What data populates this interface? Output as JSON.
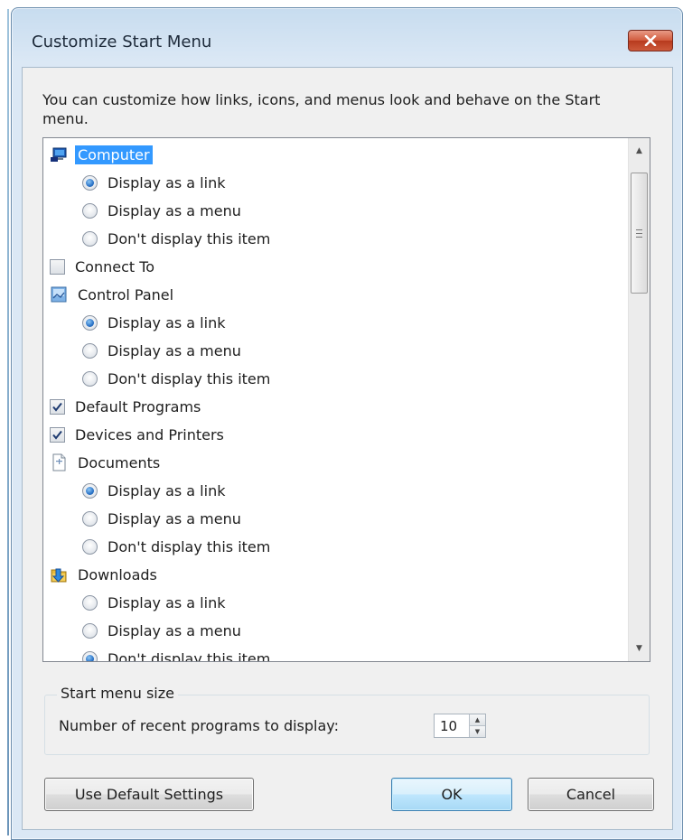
{
  "window": {
    "title": "Customize Start Menu"
  },
  "intro_text": "You can customize how links, icons, and menus look and behave on the Start menu.",
  "list": {
    "rows": [
      {
        "kind": "category",
        "label": "Computer",
        "icon": "computer-icon",
        "selected": true
      },
      {
        "kind": "radio",
        "label": "Display as a link",
        "checked": true
      },
      {
        "kind": "radio",
        "label": "Display as a menu",
        "checked": false
      },
      {
        "kind": "radio",
        "label": "Don't display this item",
        "checked": false
      },
      {
        "kind": "checkbox",
        "label": "Connect To",
        "checked": false
      },
      {
        "kind": "category",
        "label": "Control Panel",
        "icon": "control-panel-icon",
        "selected": false
      },
      {
        "kind": "radio",
        "label": "Display as a link",
        "checked": true
      },
      {
        "kind": "radio",
        "label": "Display as a menu",
        "checked": false
      },
      {
        "kind": "radio",
        "label": "Don't display this item",
        "checked": false
      },
      {
        "kind": "checkbox",
        "label": "Default Programs",
        "checked": true
      },
      {
        "kind": "checkbox",
        "label": "Devices and Printers",
        "checked": true
      },
      {
        "kind": "category",
        "label": "Documents",
        "icon": "documents-icon",
        "selected": false
      },
      {
        "kind": "radio",
        "label": "Display as a link",
        "checked": true
      },
      {
        "kind": "radio",
        "label": "Display as a menu",
        "checked": false
      },
      {
        "kind": "radio",
        "label": "Don't display this item",
        "checked": false
      },
      {
        "kind": "category",
        "label": "Downloads",
        "icon": "downloads-icon",
        "selected": false
      },
      {
        "kind": "radio",
        "label": "Display as a link",
        "checked": false
      },
      {
        "kind": "radio",
        "label": "Display as a menu",
        "checked": false
      },
      {
        "kind": "radio",
        "label": "Don't display this item",
        "checked": true
      }
    ]
  },
  "start_menu_size": {
    "group_label": "Start menu size",
    "recent_programs_label": "Number of recent programs to display:",
    "recent_programs_value": "10"
  },
  "buttons": {
    "use_default": "Use Default Settings",
    "ok": "OK",
    "cancel": "Cancel"
  },
  "colors": {
    "selection": "#3399ff",
    "close_button": "#c7452a"
  }
}
